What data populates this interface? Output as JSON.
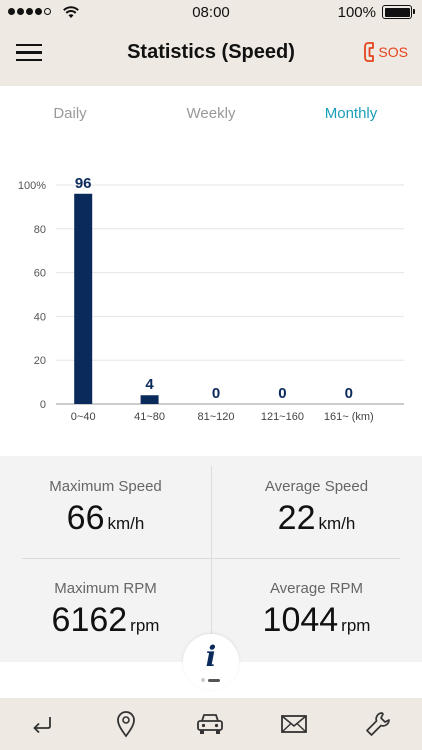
{
  "status_bar": {
    "time": "08:00",
    "battery": "100%"
  },
  "header": {
    "title": "Statistics (Speed)",
    "sos_label": "SOS",
    "accent_color": "#e4441d"
  },
  "tabs": [
    {
      "label": "Daily",
      "active": false
    },
    {
      "label": "Weekly",
      "active": false
    },
    {
      "label": "Monthly",
      "active": true
    }
  ],
  "active_tab_color": "#1aa0b8",
  "chart_data": {
    "type": "bar",
    "categories": [
      "0~40",
      "41~80",
      "81~120",
      "121~160",
      "161~ (km)"
    ],
    "values": [
      96,
      4,
      0,
      0,
      0
    ],
    "data_labels": [
      "96",
      "4",
      "0",
      "0",
      "0"
    ],
    "yticks": [
      "0",
      "20",
      "40",
      "60",
      "80",
      "100%"
    ],
    "ylim": [
      0,
      100
    ],
    "grid": true,
    "bar_color": "#0b2a5c"
  },
  "stats": {
    "max_speed": {
      "label": "Maximum Speed",
      "value": "66",
      "unit": "km/h"
    },
    "avg_speed": {
      "label": "Average Speed",
      "value": "22",
      "unit": "km/h"
    },
    "max_rpm": {
      "label": "Maximum RPM",
      "value": "6162",
      "unit": "rpm"
    },
    "avg_rpm": {
      "label": "Average RPM",
      "value": "1044",
      "unit": "rpm"
    }
  },
  "info_button": "i",
  "bottom_nav": [
    {
      "icon": "return-icon"
    },
    {
      "icon": "location-pin-icon"
    },
    {
      "icon": "car-icon"
    },
    {
      "icon": "mail-icon"
    },
    {
      "icon": "wrench-icon"
    }
  ]
}
